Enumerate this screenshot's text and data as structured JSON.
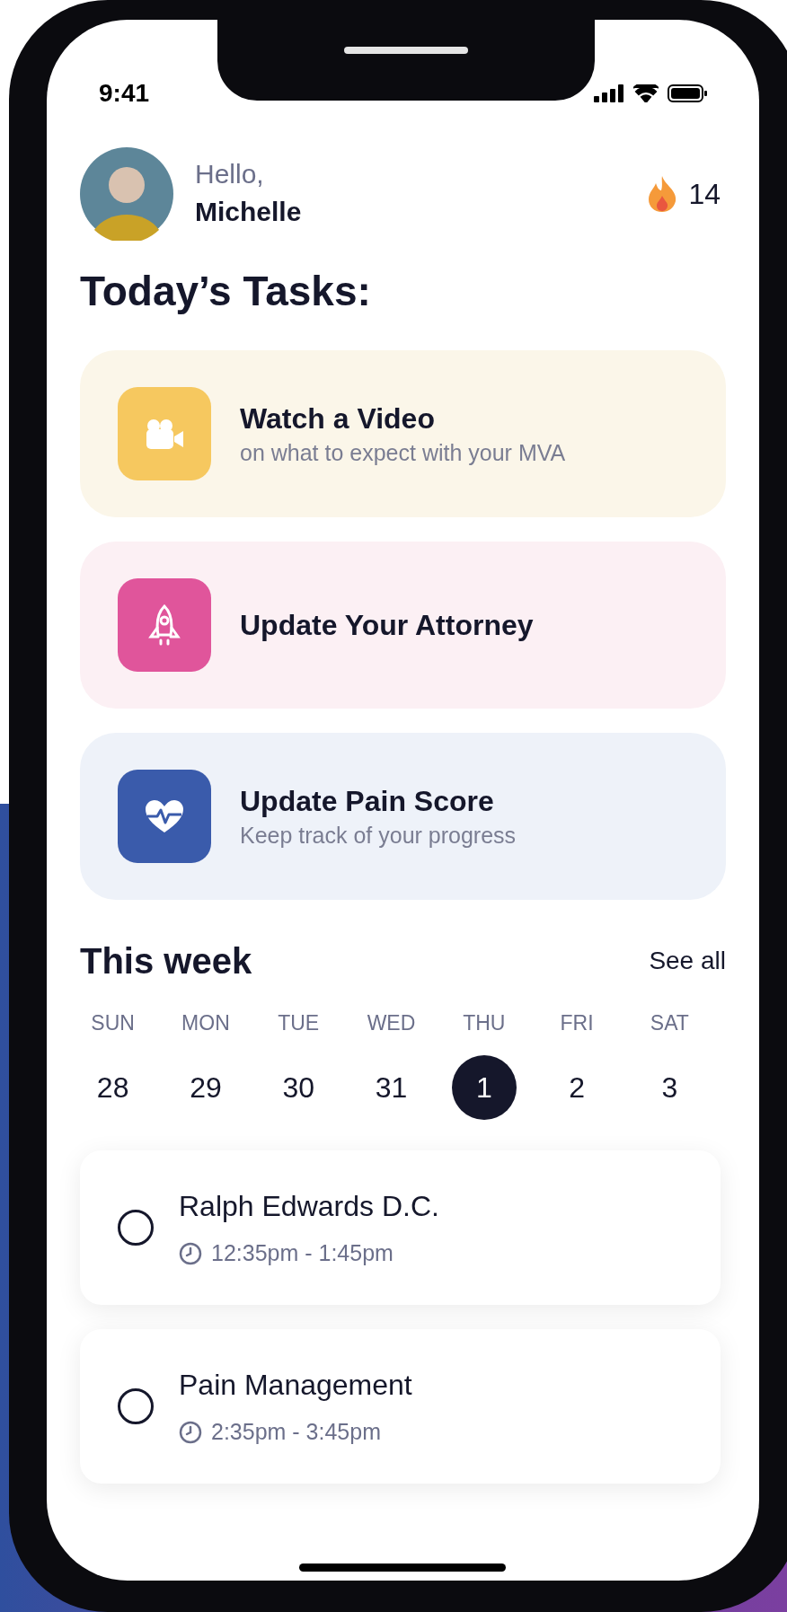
{
  "status_bar": {
    "time": "9:41"
  },
  "greeting": {
    "hello": "Hello,",
    "name": "Michelle"
  },
  "streak": {
    "count": "14"
  },
  "title": "Today’s Tasks:",
  "tasks": [
    {
      "kind": "video",
      "title": "Watch a Video",
      "subtitle": "on what to expect with your MVA",
      "color": "#f6c85f"
    },
    {
      "kind": "rocket",
      "title": "Update Your Attorney",
      "color": "#e0559b"
    },
    {
      "kind": "heart",
      "title": "Update Pain Score",
      "subtitle": "Keep track of your progress",
      "color": "#3a5bab"
    }
  ],
  "week": {
    "title": "This week",
    "link": "See all",
    "days": [
      {
        "label": "SUN",
        "date": "28",
        "selected": false
      },
      {
        "label": "MON",
        "date": "29",
        "selected": false
      },
      {
        "label": "TUE",
        "date": "30",
        "selected": false
      },
      {
        "label": "WED",
        "date": "31",
        "selected": false
      },
      {
        "label": "THU",
        "date": "1",
        "selected": true
      },
      {
        "label": "FRI",
        "date": "2",
        "selected": false
      },
      {
        "label": "SAT",
        "date": "3",
        "selected": false
      }
    ]
  },
  "appointments": [
    {
      "title": "Ralph Edwards D.C.",
      "time": "12:35pm - 1:45pm",
      "checked": false
    },
    {
      "title": "Pain Management",
      "time": "2:35pm - 3:45pm",
      "checked": false
    }
  ]
}
